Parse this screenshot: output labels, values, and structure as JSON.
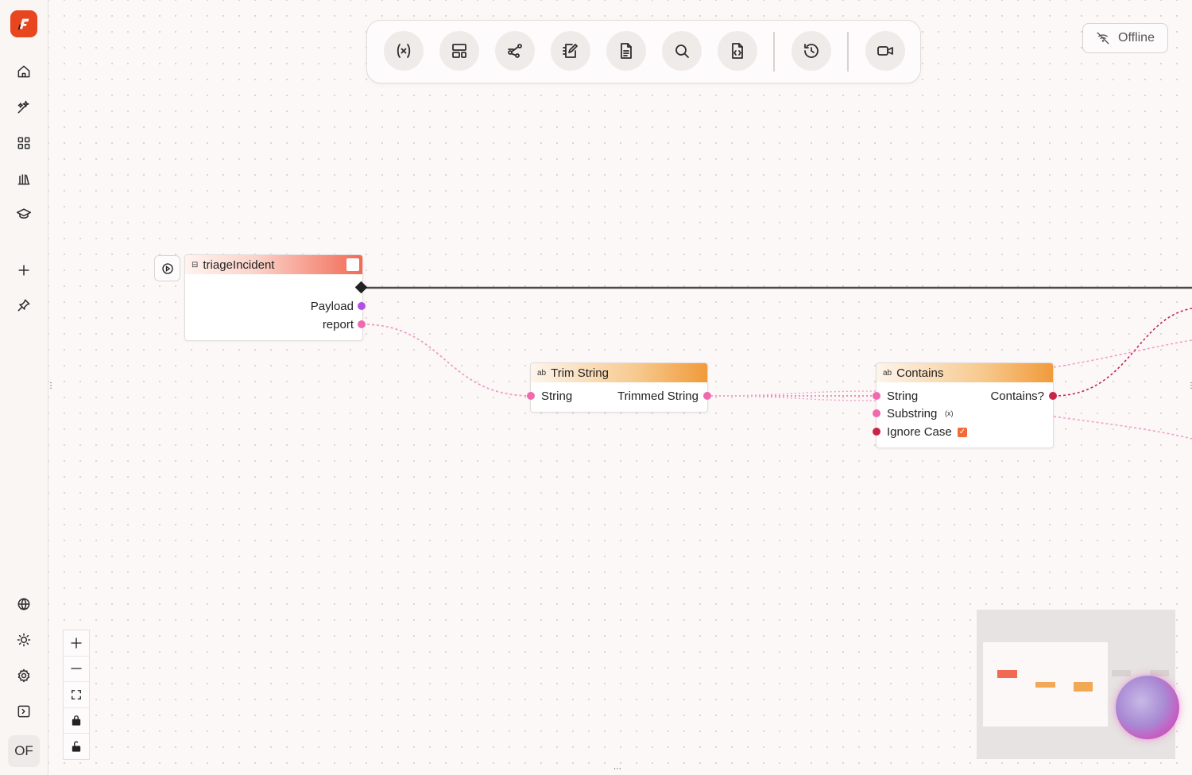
{
  "sidebar": {
    "icons": [
      "home-icon",
      "sparkles-icon",
      "grid-icon",
      "library-icon",
      "graduation-cap-icon",
      "plus-icon",
      "pin-icon",
      "globe-icon",
      "sun-icon",
      "gear-icon",
      "panel-toggle-icon"
    ],
    "avatar": "OF"
  },
  "toolbar": {
    "buttons": [
      "variable-icon",
      "layout-icon",
      "graph-icon",
      "edit-icon",
      "document-icon",
      "search-icon",
      "code-file-icon",
      "history-icon",
      "video-icon"
    ]
  },
  "status": {
    "label": "Offline"
  },
  "nodes": {
    "trigger": {
      "title": "triageIncident",
      "outputs": [
        "Payload",
        "report"
      ]
    },
    "trim": {
      "title": "Trim String",
      "input": "String",
      "output": "Trimmed String"
    },
    "contains": {
      "title": "Contains",
      "inputs": [
        "String",
        "Substring",
        "Ignore Case"
      ],
      "output": "Contains?",
      "ignore_case_checked": true
    }
  },
  "colors": {
    "accent": "#e8461e",
    "trigger_header_from": "#fff1ee",
    "trigger_header_to": "#f06a55",
    "fn_header_from": "#fdf2e6",
    "fn_header_to": "#f19a3a",
    "port_pink": "#ee6aae",
    "port_purple": "#b44ee8",
    "port_red": "#c8244a"
  }
}
